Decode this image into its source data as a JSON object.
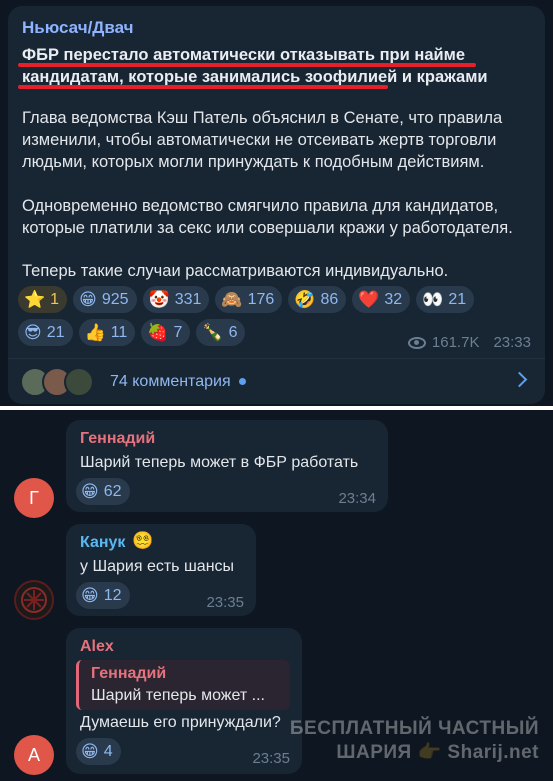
{
  "post": {
    "channel": "Ньюсач/Двач",
    "headline": "ФБР перестало автоматически отказывать при найме кандидатам, которые занимались зоофилией и кражами",
    "paragraphs": [
      "Глава ведомства Кэш Патель объяснил в Сенате, что правила изменили, чтобы автоматически не отсеивать жертв торговли людьми, которых могли принуждать к подобным действиям.",
      "Одновременно ведомство смягчило правила для кандидатов, которые платили за секс или совершали кражи у работодателя.",
      "Теперь такие случаи рассматриваются индивидуально."
    ],
    "reactions_row1": [
      {
        "emoji": "⭐",
        "count": "1",
        "kind": "star"
      },
      {
        "emoji": "😁",
        "count": "925"
      },
      {
        "emoji": "🤡",
        "count": "331"
      },
      {
        "emoji": "🙈",
        "count": "176"
      },
      {
        "emoji": "🤣",
        "count": "86"
      },
      {
        "emoji": "❤️",
        "count": "32"
      },
      {
        "emoji": "👀",
        "count": "21"
      }
    ],
    "reactions_row2": [
      {
        "emoji": "😎",
        "count": "21"
      },
      {
        "emoji": "👍",
        "count": "11"
      },
      {
        "emoji": "🍓",
        "count": "7"
      },
      {
        "emoji": "🍾",
        "count": "6"
      }
    ],
    "views": "161.7K",
    "time": "23:33",
    "comments_label": "74 комментария"
  },
  "comments": [
    {
      "author": "Геннадий",
      "author_color": "#e5737d",
      "avatar_letter": "Г",
      "avatar_color": "#e0574a",
      "text": "Шарий теперь может в ФБР работать",
      "reaction_emoji": "😁",
      "reaction_count": "62",
      "time": "23:34"
    },
    {
      "author": "Канук",
      "author_color": "#5ab8f0",
      "author_badge": "😵‍💫",
      "avatar_letter": "",
      "avatar_color": "#1a1a1a",
      "text": "у Шария есть шансы",
      "reaction_emoji": "😁",
      "reaction_count": "12",
      "time": "23:35"
    },
    {
      "author": "Alex",
      "author_color": "#e5737d",
      "avatar_letter": "A",
      "avatar_color": "#e0574a",
      "quote_author": "Геннадий",
      "quote_text": "Шарий теперь может ...",
      "text": "Думаешь его принуждали?",
      "reaction_emoji": "😁",
      "reaction_count": "4",
      "time": "23:35"
    }
  ],
  "watermark": {
    "line1": "БЕСПЛАТНЫЙ ЧАСТНЫЙ",
    "line2a": "ШАРИЯ",
    "line2b": "Sharij.net",
    "hand": "👉"
  }
}
